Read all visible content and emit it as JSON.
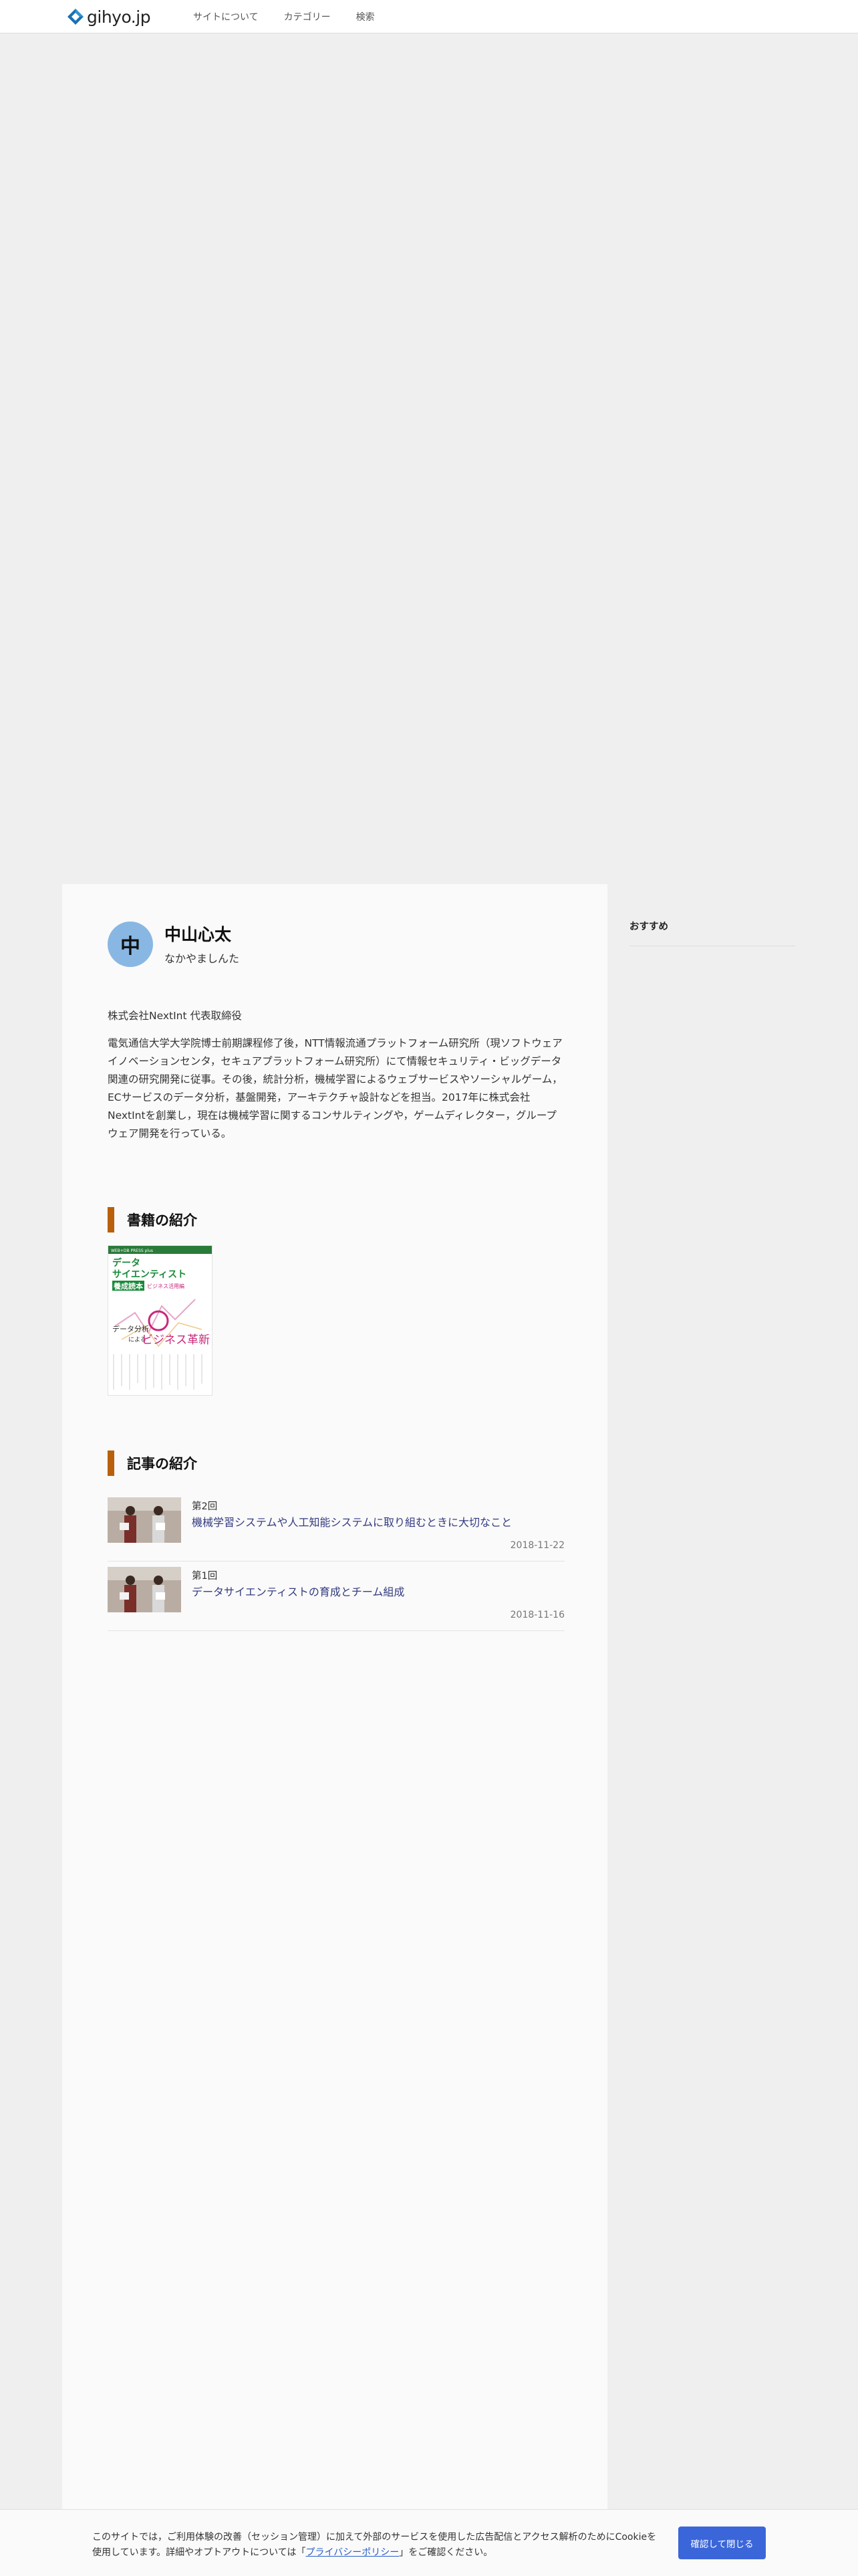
{
  "header": {
    "logo_text": "gihyo.jp",
    "nav": [
      "サイトについて",
      "カテゴリー",
      "検索"
    ]
  },
  "author": {
    "avatar_initial": "中",
    "name": "中山心太",
    "reading": "なかやましんた",
    "affiliation": "株式会社NextInt 代表取締役",
    "bio": "電気通信大学大学院博士前期課程修了後，NTT情報流通プラットフォーム研究所（現ソフトウェアイノベーションセンタ，セキュアプラットフォーム研究所）にて情報セキュリティ・ビッグデータ関連の研究開発に従事。その後，統計分析，機械学習によるウェブサービスやソーシャルゲーム，ECサービスのデータ分析，基盤開発，アーキテクチャ設計などを担当。2017年に株式会社NextIntを創業し，現在は機械学習に関するコンサルティングや，ゲームディレクター，グループウェア開発を行っている。"
  },
  "books_section": {
    "heading": "書籍の紹介",
    "book": {
      "series": "WEB+DB PRESS plus",
      "title_line1": "データ",
      "title_line2": "サイエンティスト",
      "title_line3": "養成読本",
      "title_tag": "ビジネス活用編",
      "cover_text_small": "データ分析",
      "cover_text_small2": "による",
      "cover_text_big": "ビジネス革新"
    }
  },
  "articles_section": {
    "heading": "記事の紹介",
    "items": [
      {
        "number": "第2回",
        "title": "機械学習システムや人工知能システムに取り組むときに大切なこと",
        "date": "2018-11-22"
      },
      {
        "number": "第1回",
        "title": "データサイエンティストの育成とチーム組成",
        "date": "2018-11-16"
      }
    ]
  },
  "sidebar": {
    "title": "おすすめ"
  },
  "cookie": {
    "text_before": "このサイトでは，ご利用体験の改善（セッション管理）に加えて外部のサービスを使用した広告配信とアクセス解析のためにCookieを使用しています。詳細やオプトアウトについては「",
    "link_text": "プライバシーポリシー",
    "text_after": "」をご確認ください。",
    "button": "確認して閉じる"
  },
  "colors": {
    "accent_bar": "#b8600b",
    "link": "#333b80",
    "button": "#3b66d9",
    "avatar": "#89b7e3"
  }
}
